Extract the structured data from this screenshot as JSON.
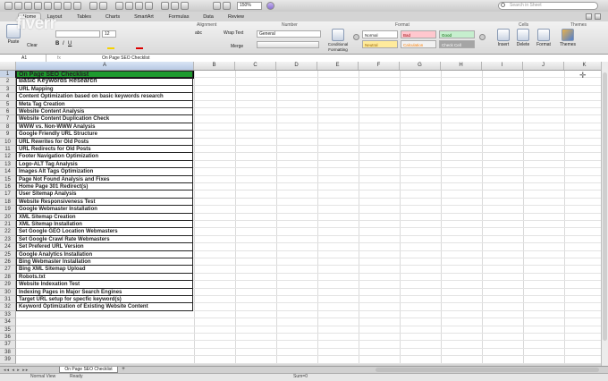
{
  "toolbar": {
    "zoom": "150%",
    "search_placeholder": "Search in Sheet"
  },
  "ribbon_tabs": [
    "Home",
    "Layout",
    "Tables",
    "Charts",
    "SmartArt",
    "Formulas",
    "Data",
    "Review"
  ],
  "ribbon": {
    "groups": {
      "alignment": "Alignment",
      "number": "Number",
      "format": "Format",
      "cells": "Cells",
      "themes": "Themes"
    },
    "font_size": "12",
    "paste": "Paste",
    "clear": "Clear",
    "abc": "abc",
    "wrap_text": "Wrap Text",
    "merge": "Merge",
    "number_format": "General",
    "conditional_formatting": "Conditional Formatting",
    "styles": {
      "normal": "Normal",
      "bad": "Bad",
      "good": "Good",
      "neutral": "Neutral",
      "calculation": "Calculation",
      "check_cell": "Check Cell"
    },
    "insert": "Insert",
    "delete": "Delete",
    "format_btn": "Format",
    "themes_btn": "Themes"
  },
  "formula_bar": {
    "name_box": "A1",
    "content": "On Page SEO Checklist"
  },
  "columns": [
    "A",
    "B",
    "C",
    "D",
    "E",
    "F",
    "G",
    "H",
    "I",
    "J",
    "K"
  ],
  "rows": [
    "On Page SEO Checklist",
    "Basic Keywords Research",
    "URL Mapping",
    "Content Optimization based on basic keywords research",
    "Meta Tag Creation",
    "Website Content Analysis",
    "Website Content Duplication Check",
    "WWW vs. Non-WWW Analysis",
    "Google Friendly URL Structure",
    "URL Rewrites for Old Posts",
    "URL Redirects for Old Posts",
    "Footer Navigation Optimization",
    "Logo-ALT Tag Analysis",
    "Images Alt Tags Optimization",
    "Page Not Found Analysis and Fixes",
    "Home Page 301 Redirect(s)",
    "User Sitemap Analysis",
    "Website Responsiveness Test",
    "Google Webmaster Installation",
    "XML Sitemap Creation",
    "XML Sitemap Installation",
    "Set Google GEO Location Webmasters",
    "Set Google Crawl Rate Webmasters",
    "Set Prefered URL Version",
    "Google Analytics Installation",
    "Bing Webmaster Installation",
    "Bing XML Sitemap Upload",
    "Robots.txt",
    "Website Indexation Test",
    "Indexing Pages in Major Search Engines",
    "Target URL setup for specfic keyword(s)",
    "Keyword Optimization of Existing Website Content"
  ],
  "empty_row_numbers": [
    "33",
    "34",
    "35",
    "36",
    "37",
    "38",
    "39"
  ],
  "sheet_tab": "On Page SEO Checklist",
  "status": {
    "view": "Normal View",
    "state": "Ready",
    "sum": "Sum=0"
  },
  "watermark": "fiverr",
  "colors": {
    "header_fill": "#1e9a2e",
    "selected_header": "#b8c9e4"
  }
}
